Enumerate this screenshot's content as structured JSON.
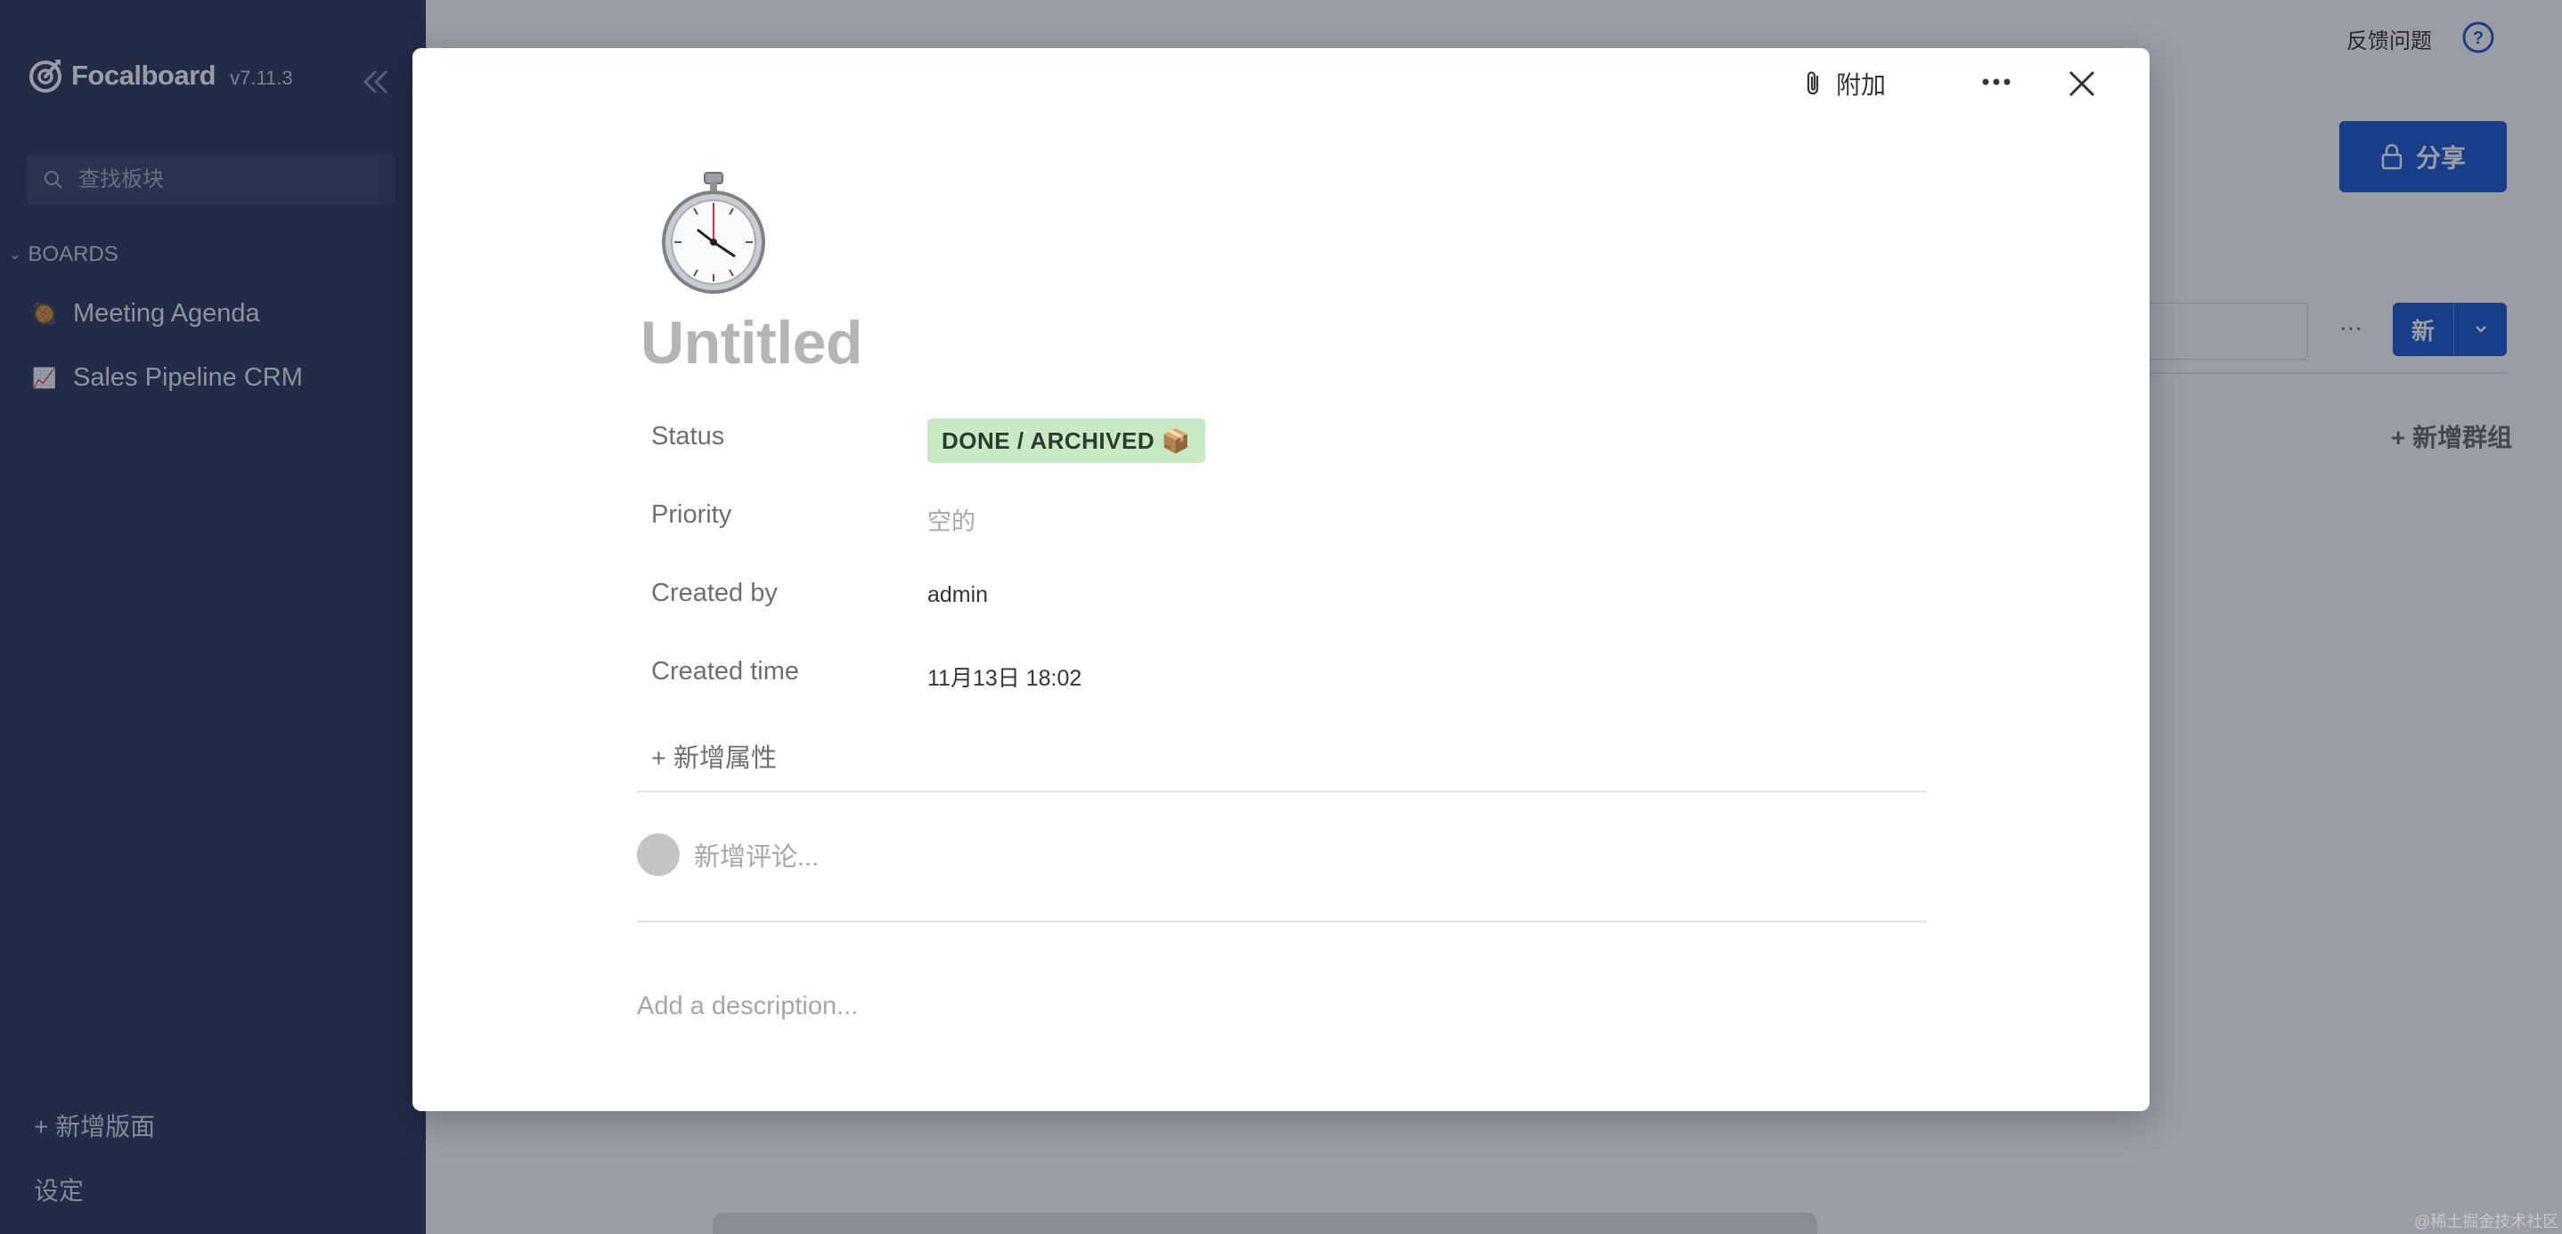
{
  "sidebar": {
    "brand": "Focalboard",
    "version": "v7.11.3",
    "search_placeholder": "查找板块",
    "boards_header": "BOARDS",
    "boards": [
      {
        "icon": "🥘",
        "label": "Meeting Agenda"
      },
      {
        "icon": "📈",
        "label": "Sales Pipeline CRM"
      }
    ],
    "add_board": "+ 新增版面",
    "settings": "设定"
  },
  "header": {
    "feedback": "反馈问题",
    "share": "分享",
    "new": "新",
    "add_group": "+ 新增群组",
    "more": "···"
  },
  "card": {
    "attach": "附加",
    "icon": "⏱️",
    "title": "Untitled",
    "properties": [
      {
        "label": "Status",
        "value": "DONE / ARCHIVED 📦"
      },
      {
        "label": "Priority",
        "value": "空的"
      },
      {
        "label": "Created by",
        "value": "admin"
      },
      {
        "label": "Created time",
        "value": "11月13日 18:02"
      }
    ],
    "add_property": "+ 新增属性",
    "comment_placeholder": "新增评论...",
    "description_placeholder": "Add a description..."
  },
  "watermark": "@稀土掘金技术社区",
  "colors": {
    "sidebar": "#2f3c5e",
    "accent": "#1e5bcf",
    "status_bg": "#c7eac4"
  }
}
